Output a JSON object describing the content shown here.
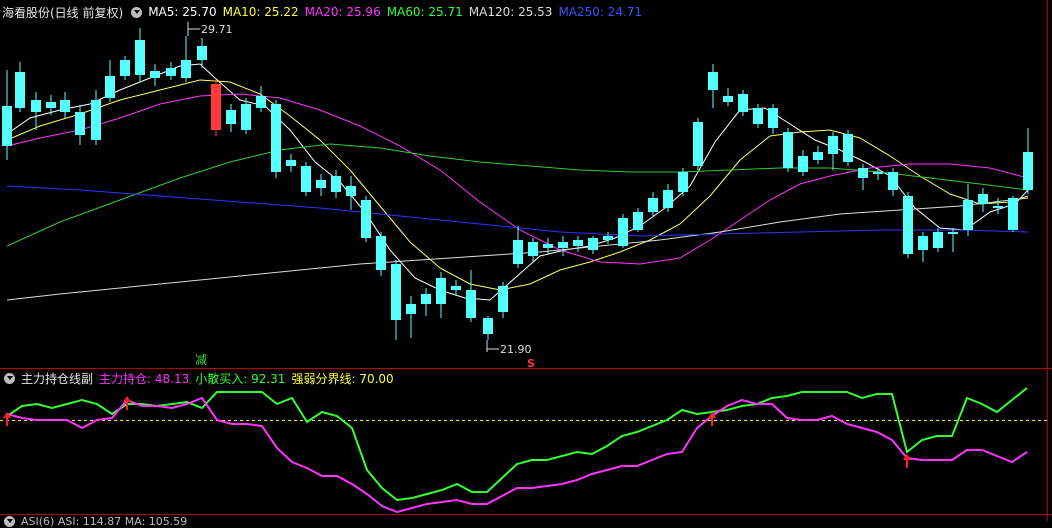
{
  "header": {
    "stock_title": "海看股份(日线 前复权)",
    "ma5": "MA5: 25.70",
    "ma10": "MA10: 25.22",
    "ma20": "MA20: 25.96",
    "ma60": "MA60: 25.71",
    "ma120": "MA120: 25.53",
    "ma250": "MA250: 24.71"
  },
  "main_chart": {
    "high_label": "29.71",
    "low_label": "21.90",
    "reduce_marker": "减",
    "sell_marker": "S"
  },
  "indicator": {
    "title": "主力持仓线副",
    "main_holding": "主力持仓: 48.13",
    "retail_buy": "小散买入: 92.31",
    "threshold": "强弱分界线: 70.00"
  },
  "bottom_panel": {
    "label": "ASI(6) ASI: 114.87 MA: 105.59"
  },
  "colors": {
    "up": "#ff3b3b",
    "down": "#54ffff",
    "ma5": "#ffffff",
    "ma10": "#ffff66",
    "ma20": "#ff33ff",
    "ma60": "#33cc33",
    "ma120": "#dddddd",
    "ma250": "#3333ff",
    "main_line": "#ff33ff",
    "retail_line": "#33ff33",
    "threshold_line": "#ffff00"
  },
  "chart_data": [
    {
      "type": "line",
      "title": "海看股份(日线 前复权)",
      "annotations": [
        "29.71",
        "21.90"
      ],
      "series": [
        {
          "name": "MA5",
          "last": 25.7
        },
        {
          "name": "MA10",
          "last": 25.22
        },
        {
          "name": "MA20",
          "last": 25.96
        },
        {
          "name": "MA60",
          "last": 25.71
        },
        {
          "name": "MA120",
          "last": 25.53
        },
        {
          "name": "MA250",
          "last": 24.71
        }
      ]
    },
    {
      "type": "line",
      "title": "主力持仓线副",
      "series": [
        {
          "name": "主力持仓",
          "last": 48.13
        },
        {
          "name": "小散买入",
          "last": 92.31
        },
        {
          "name": "强弱分界线",
          "last": 70.0
        }
      ]
    }
  ]
}
